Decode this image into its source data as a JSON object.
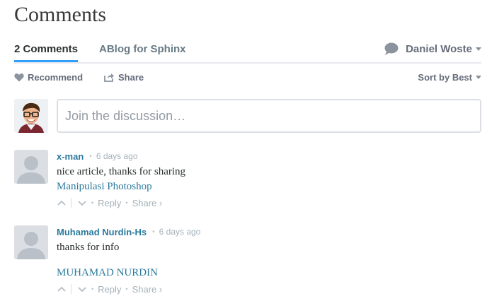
{
  "page": {
    "heading": "Comments"
  },
  "navbar": {
    "comment_count": "2 Comments",
    "forum_name": "ABlog for Sphinx",
    "user_name": "Daniel Woste"
  },
  "toolbar": {
    "recommend_label": "Recommend",
    "share_label": "Share",
    "sort_label": "Sort by Best"
  },
  "composer": {
    "placeholder": "Join the discussion…"
  },
  "comments": [
    {
      "author": "x-man",
      "time": "6 days ago",
      "lines": [
        "nice article, thanks for sharing"
      ],
      "link": "Manipulasi Photoshop",
      "reply_label": "Reply",
      "share_label": "Share ›"
    },
    {
      "author": "Muhamad Nurdin-Hs",
      "time": "6 days ago",
      "lines": [
        "thanks for info"
      ],
      "link": "MUHAMAD NURDIN",
      "reply_label": "Reply",
      "share_label": "Share ›"
    }
  ],
  "colors": {
    "accent": "#2e9fff",
    "link": "#2a7a9c",
    "muted": "#656c7a"
  }
}
